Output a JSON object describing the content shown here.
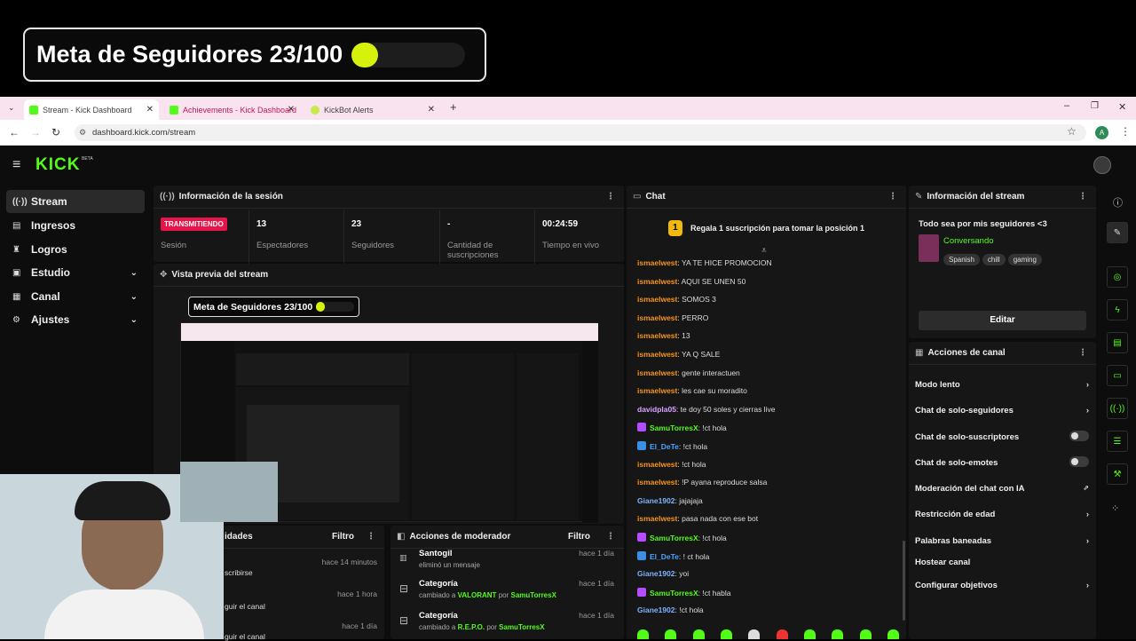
{
  "overlay": {
    "goal_text": "Meta de Seguidores 23/100",
    "goal_progress": 0.23
  },
  "browser": {
    "tabs": [
      {
        "label": "Stream - Kick Dashboard"
      },
      {
        "label": "Achievements - Kick Dashboard"
      },
      {
        "label": "KickBot Alerts"
      }
    ],
    "url": "dashboard.kick.com/stream",
    "profile_initial": "A"
  },
  "logo": "KICK",
  "logo_badge": "BETA",
  "sidebar": {
    "items": [
      {
        "label": "Stream",
        "icon": "stream-icon"
      },
      {
        "label": "Ingresos",
        "icon": "money-icon"
      },
      {
        "label": "Logros",
        "icon": "trophy-icon"
      },
      {
        "label": "Estudio",
        "icon": "studio-icon"
      },
      {
        "label": "Canal",
        "icon": "channel-icon"
      },
      {
        "label": "Ajustes",
        "icon": "gear-icon"
      }
    ]
  },
  "session": {
    "title": "Información de la sesión",
    "status": "TRANSMITIENDO",
    "status_label": "Sesión",
    "stats": [
      {
        "value": "13",
        "label": "Espectadores"
      },
      {
        "value": "23",
        "label": "Seguidores"
      },
      {
        "value": "-",
        "label": "Cantidad de suscripciones"
      },
      {
        "value": "00:24:59",
        "label": "Tiempo en vivo"
      }
    ]
  },
  "preview": {
    "title": "Vista previa del stream",
    "goal_text": "Meta de Seguidores 23/100"
  },
  "activity": {
    "title": "idades",
    "filter": "Filtro",
    "items": [
      {
        "text": "scribirse",
        "time": "hace 14 minutos"
      },
      {
        "text": "guir el canal",
        "time": "hace 1 hora"
      },
      {
        "text": "guir el canal",
        "time": "hace 1 día"
      }
    ]
  },
  "mod": {
    "title": "Acciones de moderador",
    "filter": "Filtro",
    "items": [
      {
        "title": "Santogil",
        "sub": "eliminó un mensaje",
        "time": "hace 1 día"
      },
      {
        "title": "Categoría",
        "sub_prefix": "cambiado a",
        "value": "VALORANT",
        "by": "por",
        "user": "SamuTorresX",
        "time": "hace 1 día"
      },
      {
        "title": "Categoría",
        "sub_prefix": "cambiado a",
        "value": "R.E.P.O.",
        "by": "por",
        "user": "SamuTorresX",
        "time": "hace 1 día"
      }
    ]
  },
  "chat": {
    "title": "Chat",
    "pinned": "Regala 1 suscripción para tomar la posición 1",
    "pinned_rank": "1",
    "messages": [
      {
        "user": "ismaelwest",
        "text": ": YA TE HICE PROMOCION",
        "color": "#f7931e"
      },
      {
        "user": "ismaelwest",
        "text": ": AQUI SE UNEN 50",
        "color": "#f7931e"
      },
      {
        "user": "ismaelwest",
        "text": ": SOMOS 3",
        "color": "#f7931e"
      },
      {
        "user": "ismaelwest",
        "text": ": PERRO",
        "color": "#f7931e"
      },
      {
        "user": "ismaelwest",
        "text": ": 13",
        "color": "#f7931e"
      },
      {
        "user": "ismaelwest",
        "text": ": YA Q SALE",
        "color": "#f7931e"
      },
      {
        "user": "ismaelwest",
        "text": ": gente interactuen",
        "color": "#f7931e"
      },
      {
        "user": "ismaelwest",
        "text": ": les cae su moradito",
        "color": "#f7931e"
      },
      {
        "user": "davidpla05",
        "text": ": te doy 50 soles y cierras live",
        "color": "#d9a3ff"
      },
      {
        "user": "SamuTorresX",
        "text": ": !ct hola",
        "color": "#53fc18",
        "badge": "mic"
      },
      {
        "user": "El_DeTe",
        "text": ": !ct hola",
        "color": "#4aa3ff",
        "badge": "bot"
      },
      {
        "user": "ismaelwest",
        "text": ": !ct hola",
        "color": "#f7931e"
      },
      {
        "user": "ismaelwest",
        "text": ": !P ayana reproduce salsa",
        "color": "#f7931e"
      },
      {
        "user": "Giane1902",
        "text": ": jajajaja",
        "color": "#7fb2ff"
      },
      {
        "user": "ismaelwest",
        "text": ": pasa nada con ese bot",
        "color": "#f7931e"
      },
      {
        "user": "SamuTorresX",
        "text": ": !ct hola",
        "color": "#53fc18",
        "badge": "mic"
      },
      {
        "user": "El_DeTe",
        "text": ": ! ct hola",
        "color": "#4aa3ff",
        "badge": "bot"
      },
      {
        "user": "Giane1902",
        "text": ": yoi",
        "color": "#7fb2ff"
      },
      {
        "user": "SamuTorresX",
        "text": ": !ct habla",
        "color": "#53fc18",
        "badge": "mic"
      },
      {
        "user": "Giane1902",
        "text": ": !ct hola",
        "color": "#7fb2ff"
      }
    ]
  },
  "stream_info": {
    "title": "Información del stream",
    "stream_title": "Todo sea por mis seguidores <3",
    "category": "Conversando",
    "tags": [
      "Spanish",
      "chill",
      "gaming"
    ],
    "edit": "Editar"
  },
  "channel_actions": {
    "title": "Acciones de canal",
    "items": [
      {
        "label": "Modo lento",
        "control": "arrow"
      },
      {
        "label": "Chat de solo-seguidores",
        "control": "arrow"
      },
      {
        "label": "Chat de solo-suscriptores",
        "control": "toggle"
      },
      {
        "label": "Chat de solo-emotes",
        "control": "toggle"
      },
      {
        "label": "Moderación del chat con IA",
        "control": "external"
      },
      {
        "label": "Restricción de edad",
        "control": "arrow"
      },
      {
        "label": "Palabras baneadas",
        "control": "arrow"
      },
      {
        "label": "Hostear canal",
        "control": "none"
      },
      {
        "label": "Configurar objetivos",
        "control": "arrow"
      }
    ]
  }
}
